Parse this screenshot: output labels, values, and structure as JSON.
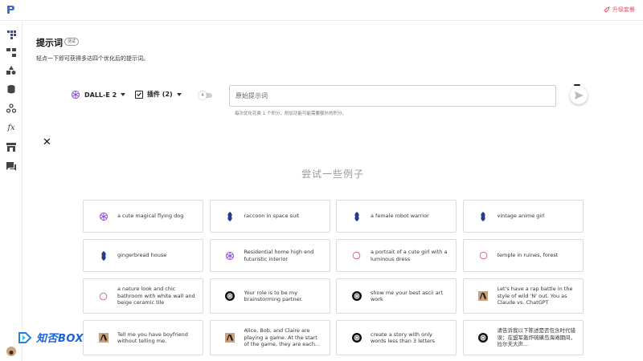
{
  "header": {
    "feedback_label": "升级套餐",
    "accent_color": "#e0506a"
  },
  "sidebar": {
    "icons": [
      "prompt-icon",
      "flow-icon",
      "shapes-icon",
      "database-icon",
      "webhook-icon",
      "function-icon",
      "store-icon",
      "chat-icon"
    ]
  },
  "page": {
    "title": "提示词",
    "badge": "测试",
    "subtitle": "轻点一下即可获得多达四个优化后的提示词。"
  },
  "controls": {
    "model_label": "DALL-E 2",
    "plugins_label": "插件 (2)",
    "toggle_label": "4",
    "prompt_placeholder": "原始提示词",
    "hint": "每次优化花费 1 个积分，附加功能可能需要额外的积分。"
  },
  "examples": {
    "heading": "尝试一些例子",
    "items": [
      {
        "icon": "openai-icon",
        "text": "a cute magical flying dog"
      },
      {
        "icon": "mj-boat-icon",
        "text": "raccoon in space suit"
      },
      {
        "icon": "mj-boat-icon",
        "text": "a female robot warrior"
      },
      {
        "icon": "mj-boat-icon",
        "text": "vintage anime girl"
      },
      {
        "icon": "mj-boat-icon",
        "text": "gingerbread house"
      },
      {
        "icon": "openai-icon",
        "text": "Residential home high end futuristic interior"
      },
      {
        "icon": "circle-icon",
        "text": "a portrait of a cute girl with a luminous dress"
      },
      {
        "icon": "circle-icon",
        "text": "temple in ruines, forest"
      },
      {
        "icon": "circle-icon",
        "text": "a nature look and chic bathroom with white wall and beige ceramic tile"
      },
      {
        "icon": "chatgpt-icon",
        "text": "Your role is to be my brainstorming partner."
      },
      {
        "icon": "chatgpt-icon",
        "text": "show me your best ascii art work"
      },
      {
        "icon": "anthropic-icon",
        "text": "Let's have a rap battle in the style of wild 'N' out. You as Claude vs. ChatGPT"
      },
      {
        "icon": "anthropic-icon",
        "text": "Tell me you have boyfriend without telling me."
      },
      {
        "icon": "anthropic-icon",
        "text": "Alice, Bob, and Claire are playing a game. At the start of the game, they are each..."
      },
      {
        "icon": "chatgpt-icon",
        "text": "create a story with only words less than 3 letters"
      },
      {
        "icon": "chatgpt-icon",
        "text": "请告诉我以下陈述是否包含时代错误：在盟军轰炸硫磺岛海滩期间，拉尔夫大声..."
      }
    ]
  },
  "watermark": {
    "text": "知否BOX"
  }
}
